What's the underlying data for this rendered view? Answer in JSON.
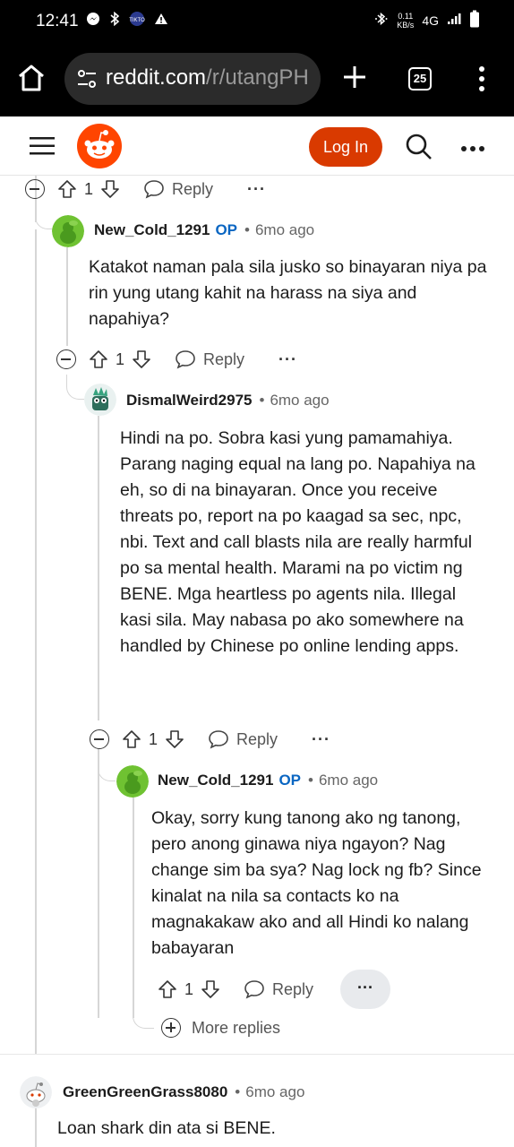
{
  "status_bar": {
    "time": "12:41",
    "speed_value": "0.11",
    "speed_unit": "KB/s",
    "network": "4G"
  },
  "browser": {
    "url_host": "reddit.com",
    "url_path": "/r/utangPH",
    "tab_count": "25"
  },
  "header": {
    "login_label": "Log In",
    "brand_color": "#d93a00"
  },
  "comments": [
    {
      "id": "top-actions",
      "score": "1",
      "reply_label": "Reply"
    },
    {
      "author": "New_Cold_1291",
      "op_badge": "OP",
      "age": "6mo ago",
      "body": "Katakot naman pala sila jusko so binayaran niya pa rin yung utang kahit na harass na siya and napahiya?",
      "score": "1",
      "reply_label": "Reply"
    },
    {
      "author": "DismalWeird2975",
      "age": "6mo ago",
      "body": "Hindi na po. Sobra kasi yung pamamahiya. Parang naging equal na lang po. Napahiya na eh, so di na binayaran. Once you receive threats po, report na po kaagad sa sec, npc, nbi. Text and call blasts nila are really harmful po sa mental health. Marami na po victim ng BENE. Mga heartless po agents nila. Illegal kasi sila. May nabasa po ako somewhere na handled by Chinese po online lending apps.",
      "score": "1",
      "reply_label": "Reply"
    },
    {
      "author": "New_Cold_1291",
      "op_badge": "OP",
      "age": "6mo ago",
      "body": "Okay, sorry kung tanong ako ng tanong, pero anong ginawa niya ngayon? Nag change sim ba sya? Nag lock ng fb? Since kinalat na nila sa contacts ko na magnakakaw ako and all Hindi ko nalang babayaran",
      "score": "1",
      "reply_label": "Reply"
    },
    {
      "author": "GreenGreenGrass8080",
      "age": "6mo ago",
      "body": "Loan shark din ata si BENE."
    }
  ],
  "more_replies_label": "More replies"
}
